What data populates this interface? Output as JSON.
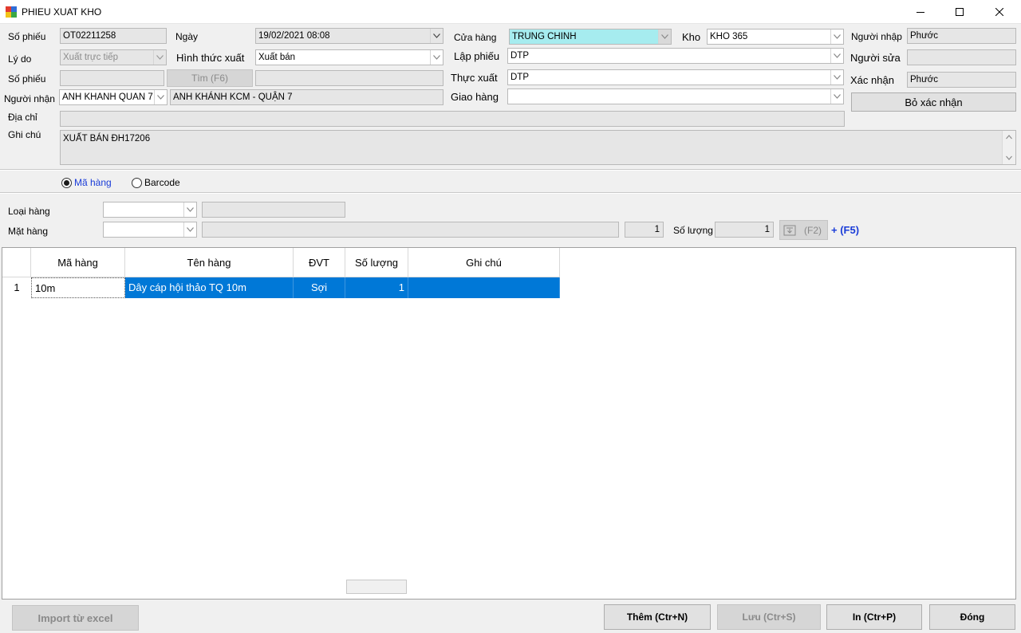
{
  "window": {
    "title": "PHIEU XUAT KHO"
  },
  "header": {
    "so_phieu_label": "Số phiếu",
    "so_phieu_value": "OT02211258",
    "ngay_label": "Ngày",
    "ngay_value": "19/02/2021 08:08",
    "cua_hang_label": "Cửa hàng",
    "cua_hang_value": "TRUNG CHINH",
    "kho_label": "Kho",
    "kho_value": "KHO 365",
    "nguoi_nhap_label": "Người nhập",
    "nguoi_nhap_value": "Phước",
    "ly_do_label": "Lý do",
    "ly_do_value": "Xuất trực tiếp",
    "hinh_thuc_label": "Hình thức xuất",
    "hinh_thuc_value": "Xuất bán",
    "lap_phieu_label": "Lập phiếu",
    "lap_phieu_value": "DTP",
    "nguoi_sua_label": "Người sửa",
    "nguoi_sua_value": "",
    "so_phieu2_label": "Số phiếu",
    "so_phieu2_value": "",
    "tim_button": "Tìm (F6)",
    "tim_result": "",
    "thuc_xuat_label": "Thực xuất",
    "thuc_xuat_value": "DTP",
    "xac_nhan_label": "Xác nhận",
    "xac_nhan_value": "Phước",
    "nguoi_nhan_label": "Người nhận",
    "nguoi_nhan_value": "ANH KHANH QUAN 7",
    "nguoi_nhan_name": "ANH KHÁNH KCM - QUẬN 7",
    "giao_hang_label": "Giao hàng",
    "giao_hang_value": "",
    "bo_xac_nhan_button": "Bỏ xác nhận",
    "dia_chi_label": "Địa chỉ",
    "dia_chi_value": "",
    "ghi_chu_label": "Ghi chú",
    "ghi_chu_value": "XUẤT BÁN ĐH17206"
  },
  "mode": {
    "ma_hang_label": "Mã hàng",
    "barcode_label": "Barcode",
    "selected": "ma_hang"
  },
  "entry": {
    "loai_hang_label": "Loại hàng",
    "loai_hang_value": "",
    "loai_hang_name": "",
    "mat_hang_label": "Mặt hàng",
    "mat_hang_value": "",
    "mat_hang_name": "",
    "unit_qty": "1",
    "so_luong_label": "Số lượng",
    "so_luong_value": "1",
    "f2_button": "(F2)",
    "add_f5": "+ (F5)"
  },
  "grid": {
    "columns": [
      "Mã hàng",
      "Tên hàng",
      "ĐVT",
      "Số lượng",
      "Ghi chú"
    ],
    "rows": [
      {
        "index": "1",
        "ma_hang": "10m",
        "ten_hang": "Dây cáp hội thảo TQ 10m",
        "dvt": "Sợi",
        "so_luong": "1",
        "ghi_chu": ""
      }
    ]
  },
  "footer": {
    "import_button": "Import từ excel",
    "them_button": "Thêm (Ctr+N)",
    "luu_button": "Lưu (Ctr+S)",
    "in_button": "In (Ctr+P)",
    "dong_button": "Đóng"
  },
  "colors": {
    "selection": "#0078d7",
    "cua_hang_highlight": "#a6ecef",
    "accent_text": "#1a3cd8"
  }
}
